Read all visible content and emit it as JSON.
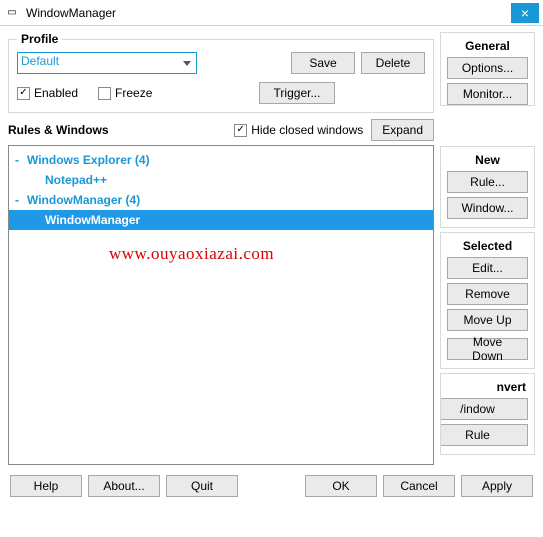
{
  "window": {
    "title": "WindowManager"
  },
  "profile": {
    "legend": "Profile",
    "selected": "Default",
    "save": "Save",
    "delete": "Delete",
    "enabled_label": "Enabled",
    "enabled_checked": true,
    "freeze_label": "Freeze",
    "freeze_checked": false,
    "trigger": "Trigger..."
  },
  "rules": {
    "title": "Rules & Windows",
    "hide_closed_label": "Hide closed windows",
    "hide_closed_checked": true,
    "expand": "Expand",
    "items": [
      {
        "label": "Windows Explorer (4)",
        "children": []
      },
      {
        "label": "Notepad++",
        "children": null
      },
      {
        "label": "WindowManager (4)",
        "children": [
          {
            "label": "WindowManager",
            "selected": true
          }
        ]
      }
    ]
  },
  "general": {
    "legend": "General",
    "options": "Options...",
    "monitor": "Monitor..."
  },
  "side_new": {
    "legend": "New",
    "rule": "Rule...",
    "window": "Window..."
  },
  "side_selected": {
    "legend": "Selected",
    "edit": "Edit...",
    "remove": "Remove",
    "moveup": "Move Up",
    "movedown": "Move Down"
  },
  "side_convert": {
    "legend": "nvert",
    "window": "/indow",
    "rule": "Rule"
  },
  "bottom": {
    "help": "Help",
    "about": "About...",
    "quit": "Quit",
    "ok": "OK",
    "cancel": "Cancel",
    "apply": "Apply"
  },
  "watermark": "www.ouyaoxiazai.com"
}
